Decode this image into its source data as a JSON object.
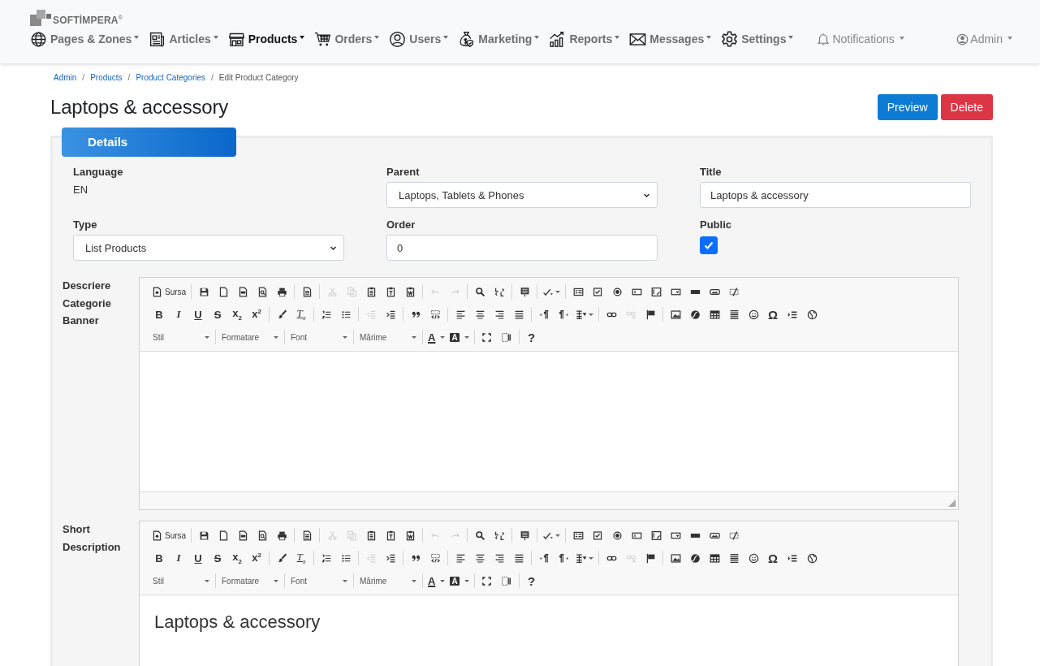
{
  "header": {
    "logo": "SOFTİMPERA$^{®}$",
    "nav": [
      {
        "kind": "globe",
        "label": "Pages & Zones",
        "selected": false
      },
      {
        "kind": "newspaper",
        "label": "Articles",
        "selected": false
      },
      {
        "kind": "store",
        "label": "Products",
        "selected": true
      },
      {
        "kind": "cart",
        "label": "Orders",
        "selected": false
      },
      {
        "kind": "user",
        "label": "Users",
        "selected": false
      },
      {
        "kind": "moneybag",
        "label": "Marketing",
        "selected": false
      },
      {
        "kind": "chart",
        "label": "Reports",
        "selected": false
      },
      {
        "kind": "envelope",
        "label": "Messages",
        "selected": false
      },
      {
        "kind": "gear",
        "label": "Settings",
        "selected": false
      }
    ],
    "notifications": "Notifications",
    "account": "Admin"
  },
  "breadcrumb_separator": "/",
  "breadcrumb": [
    {
      "label": "Admin",
      "link": true
    },
    {
      "label": "Products",
      "link": true
    },
    {
      "label": "Product Categories",
      "link": true
    },
    {
      "label": "Edit Product Category",
      "link": false
    }
  ],
  "title": "Laptops & accessory",
  "actions": [
    {
      "kind": "preview",
      "label": "Preview"
    },
    {
      "kind": "delete",
      "label": "Delete"
    }
  ],
  "tab": "Details",
  "fields": [
    {
      "kind": "static",
      "label": "Language",
      "value": "EN"
    },
    {
      "kind": "select",
      "label": "Parent",
      "value": "Laptops, Tablets & Phones"
    },
    {
      "kind": "input",
      "label": "Title",
      "value": "Laptops & accessory"
    },
    {
      "kind": "select",
      "label": "Type",
      "value": "List Products"
    },
    {
      "kind": "input",
      "label": "Order",
      "value": "0"
    },
    {
      "kind": "checkbox",
      "label": "Public",
      "checked": true
    }
  ],
  "editors": [
    {
      "label": "Descriere Categorie Banner",
      "footer": true,
      "toolbar": [
        [
          [
            {
              "kind": "source",
              "label": "Sursa",
              "disabled": false
            }
          ],
          [
            {
              "kind": "save",
              "disabled": false
            },
            {
              "kind": "newpage",
              "disabled": false
            },
            {
              "kind": "pdf",
              "disabled": false
            },
            {
              "kind": "preview",
              "disabled": false
            },
            {
              "kind": "print",
              "disabled": false
            }
          ],
          [
            {
              "kind": "templates",
              "disabled": false
            }
          ],
          [
            {
              "kind": "cut",
              "disabled": true
            },
            {
              "kind": "copy",
              "disabled": true
            },
            {
              "kind": "paste",
              "disabled": false
            },
            {
              "kind": "pastetext",
              "disabled": false
            },
            {
              "kind": "pasteword",
              "disabled": false
            }
          ],
          [
            {
              "kind": "undo",
              "disabled": true
            },
            {
              "kind": "redo",
              "disabled": true
            }
          ],
          [
            {
              "kind": "find",
              "disabled": false
            },
            {
              "kind": "replace",
              "disabled": false
            }
          ],
          [
            {
              "kind": "selectall",
              "disabled": false
            }
          ],
          [
            {
              "kind": "spell",
              "disabled": false
            }
          ],
          [
            {
              "kind": "form",
              "disabled": false
            },
            {
              "kind": "checkbox",
              "disabled": false
            },
            {
              "kind": "radio",
              "disabled": false
            },
            {
              "kind": "textfield",
              "disabled": false
            },
            {
              "kind": "textarea",
              "disabled": false
            },
            {
              "kind": "select",
              "disabled": false
            },
            {
              "kind": "button",
              "disabled": false
            },
            {
              "kind": "imagebutton",
              "disabled": false
            },
            {
              "kind": "hidden",
              "disabled": false
            }
          ]
        ],
        [
          [
            {
              "kind": "bold",
              "label": "B",
              "disabled": false
            },
            {
              "kind": "italic",
              "label": "I",
              "disabled": false
            },
            {
              "kind": "underline",
              "label": "U",
              "disabled": false
            },
            {
              "kind": "strike",
              "label": "S",
              "disabled": false
            },
            {
              "kind": "script",
              "label": "x$_{2}$",
              "disabled": false
            },
            {
              "kind": "script",
              "label": "x$^{2}$",
              "disabled": false
            }
          ],
          [
            {
              "kind": "brush",
              "disabled": false
            },
            {
              "kind": "clear",
              "label": "T$_{x}$",
              "disabled": false
            }
          ],
          [
            {
              "kind": "ol",
              "disabled": false
            },
            {
              "kind": "ul",
              "disabled": false
            }
          ],
          [
            {
              "kind": "outdent",
              "disabled": true
            },
            {
              "kind": "indent",
              "disabled": false
            }
          ],
          [
            {
              "kind": "quote",
              "disabled": false
            },
            {
              "kind": "div",
              "disabled": false
            }
          ],
          [
            {
              "kind": "alignleft",
              "disabled": false
            },
            {
              "kind": "aligncenter",
              "disabled": false
            },
            {
              "kind": "alignright",
              "disabled": false
            },
            {
              "kind": "justify",
              "disabled": false
            }
          ],
          [
            {
              "kind": "ltr",
              "disabled": false
            },
            {
              "kind": "rtl",
              "disabled": false
            },
            {
              "kind": "language",
              "disabled": false
            }
          ],
          [
            {
              "kind": "link",
              "disabled": false
            },
            {
              "kind": "unlink",
              "disabled": true
            },
            {
              "kind": "anchor",
              "disabled": false
            }
          ],
          [
            {
              "kind": "image",
              "disabled": false
            },
            {
              "kind": "flash",
              "disabled": false
            },
            {
              "kind": "table",
              "disabled": false
            },
            {
              "kind": "hr",
              "disabled": false
            },
            {
              "kind": "smiley",
              "disabled": false
            },
            {
              "kind": "symbol",
              "label": "Ω",
              "disabled": false
            },
            {
              "kind": "pagebreak",
              "disabled": false
            },
            {
              "kind": "iframe",
              "disabled": false
            }
          ]
        ],
        [
          [
            {
              "kind": "combo",
              "label": "Stil",
              "disabled": false
            }
          ],
          [
            {
              "kind": "combo",
              "label": "Formatare",
              "disabled": false
            }
          ],
          [
            {
              "kind": "combo",
              "label": "Font",
              "disabled": false
            }
          ],
          [
            {
              "kind": "combo",
              "label": "Mărime",
              "disabled": false
            }
          ],
          [
            {
              "kind": "textcolor",
              "label": "A",
              "disabled": false
            },
            {
              "kind": "bgcolor",
              "label": "A",
              "disabled": false
            }
          ],
          [
            {
              "kind": "maximize",
              "disabled": false
            },
            {
              "kind": "showblocks",
              "disabled": false
            }
          ],
          [
            {
              "kind": "help",
              "label": "?",
              "disabled": false
            }
          ]
        ]
      ]
    },
    {
      "label": "Short Description",
      "content": "Laptops & accessory",
      "footer": false,
      "toolbar": [
        [
          [
            {
              "kind": "source",
              "label": "Sursa",
              "disabled": false
            }
          ],
          [
            {
              "kind": "save",
              "disabled": false
            },
            {
              "kind": "newpage",
              "disabled": false
            },
            {
              "kind": "pdf",
              "disabled": false
            },
            {
              "kind": "preview",
              "disabled": false
            },
            {
              "kind": "print",
              "disabled": false
            }
          ],
          [
            {
              "kind": "templates",
              "disabled": false
            }
          ],
          [
            {
              "kind": "cut",
              "disabled": true
            },
            {
              "kind": "copy",
              "disabled": true
            },
            {
              "kind": "paste",
              "disabled": false
            },
            {
              "kind": "pastetext",
              "disabled": false
            },
            {
              "kind": "pasteword",
              "disabled": false
            }
          ],
          [
            {
              "kind": "undo",
              "disabled": true
            },
            {
              "kind": "redo",
              "disabled": true
            }
          ],
          [
            {
              "kind": "find",
              "disabled": false
            },
            {
              "kind": "replace",
              "disabled": false
            }
          ],
          [
            {
              "kind": "selectall",
              "disabled": false
            }
          ],
          [
            {
              "kind": "spell",
              "disabled": false
            }
          ],
          [
            {
              "kind": "form",
              "disabled": false
            },
            {
              "kind": "checkbox",
              "disabled": false
            },
            {
              "kind": "radio",
              "disabled": false
            },
            {
              "kind": "textfield",
              "disabled": false
            },
            {
              "kind": "textarea",
              "disabled": false
            },
            {
              "kind": "select",
              "disabled": false
            },
            {
              "kind": "button",
              "disabled": false
            },
            {
              "kind": "imagebutton",
              "disabled": false
            },
            {
              "kind": "hidden",
              "disabled": false
            }
          ]
        ],
        [
          [
            {
              "kind": "bold",
              "label": "B",
              "disabled": false
            },
            {
              "kind": "italic",
              "label": "I",
              "disabled": false
            },
            {
              "kind": "underline",
              "label": "U",
              "disabled": false
            },
            {
              "kind": "strike",
              "label": "S",
              "disabled": false
            },
            {
              "kind": "script",
              "label": "x$_{2}$",
              "disabled": false
            },
            {
              "kind": "script",
              "label": "x$^{2}$",
              "disabled": false
            }
          ],
          [
            {
              "kind": "brush",
              "disabled": false
            },
            {
              "kind": "clear",
              "label": "T$_{x}$",
              "disabled": false
            }
          ],
          [
            {
              "kind": "ol",
              "disabled": false
            },
            {
              "kind": "ul",
              "disabled": false
            }
          ],
          [
            {
              "kind": "outdent",
              "disabled": true
            },
            {
              "kind": "indent",
              "disabled": false
            }
          ],
          [
            {
              "kind": "quote",
              "disabled": false
            },
            {
              "kind": "div",
              "disabled": false
            }
          ],
          [
            {
              "kind": "alignleft",
              "disabled": false
            },
            {
              "kind": "aligncenter",
              "disabled": false
            },
            {
              "kind": "alignright",
              "disabled": false
            },
            {
              "kind": "justify",
              "disabled": false
            }
          ],
          [
            {
              "kind": "ltr",
              "disabled": false
            },
            {
              "kind": "rtl",
              "disabled": false
            },
            {
              "kind": "language",
              "disabled": false
            }
          ],
          [
            {
              "kind": "link",
              "disabled": false
            },
            {
              "kind": "unlink",
              "disabled": true
            },
            {
              "kind": "anchor",
              "disabled": false
            }
          ],
          [
            {
              "kind": "image",
              "disabled": false
            },
            {
              "kind": "flash",
              "disabled": false
            },
            {
              "kind": "table",
              "disabled": false
            },
            {
              "kind": "hr",
              "disabled": false
            },
            {
              "kind": "smiley",
              "disabled": false
            },
            {
              "kind": "symbol",
              "label": "Ω",
              "disabled": false
            },
            {
              "kind": "pagebreak",
              "disabled": false
            },
            {
              "kind": "iframe",
              "disabled": false
            }
          ]
        ],
        [
          [
            {
              "kind": "combo",
              "label": "Stil",
              "disabled": false
            }
          ],
          [
            {
              "kind": "combo",
              "label": "Formatare",
              "disabled": false
            }
          ],
          [
            {
              "kind": "combo",
              "label": "Font",
              "disabled": false
            }
          ],
          [
            {
              "kind": "combo",
              "label": "Mărime",
              "disabled": false
            }
          ],
          [
            {
              "kind": "textcolor",
              "label": "A",
              "disabled": false
            },
            {
              "kind": "bgcolor",
              "label": "A",
              "disabled": false
            }
          ],
          [
            {
              "kind": "maximize",
              "disabled": false
            },
            {
              "kind": "showblocks",
              "disabled": false
            }
          ],
          [
            {
              "kind": "help",
              "label": "?",
              "disabled": false
            }
          ]
        ]
      ]
    }
  ]
}
